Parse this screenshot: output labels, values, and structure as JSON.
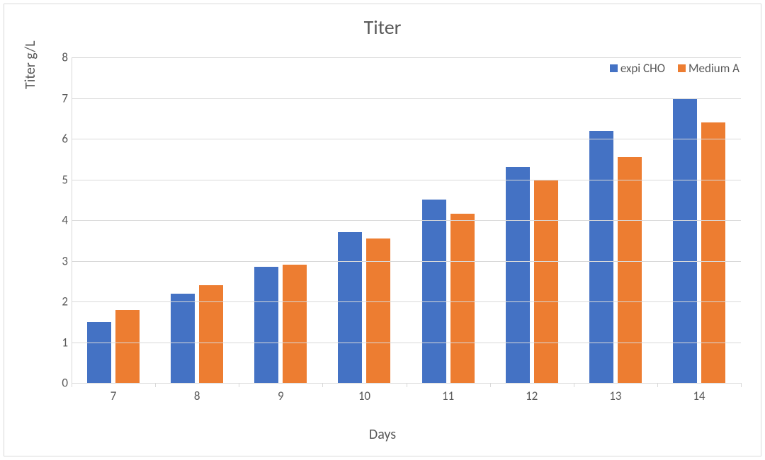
{
  "chart_data": {
    "type": "bar",
    "title": "Titer",
    "xlabel": "Days",
    "ylabel": "Titer g/L",
    "categories": [
      "7",
      "8",
      "9",
      "10",
      "11",
      "12",
      "13",
      "14"
    ],
    "series": [
      {
        "name": "expi CHO",
        "color": "#4472c4",
        "values": [
          1.5,
          2.2,
          2.85,
          3.7,
          4.5,
          5.3,
          6.2,
          7.0
        ]
      },
      {
        "name": "Medium A",
        "color": "#ed7d31",
        "values": [
          1.8,
          2.4,
          2.9,
          3.55,
          4.15,
          5.0,
          5.55,
          6.4
        ]
      }
    ],
    "ylim": [
      0,
      8
    ],
    "yticks": [
      0,
      1,
      2,
      3,
      4,
      5,
      6,
      7,
      8
    ]
  }
}
